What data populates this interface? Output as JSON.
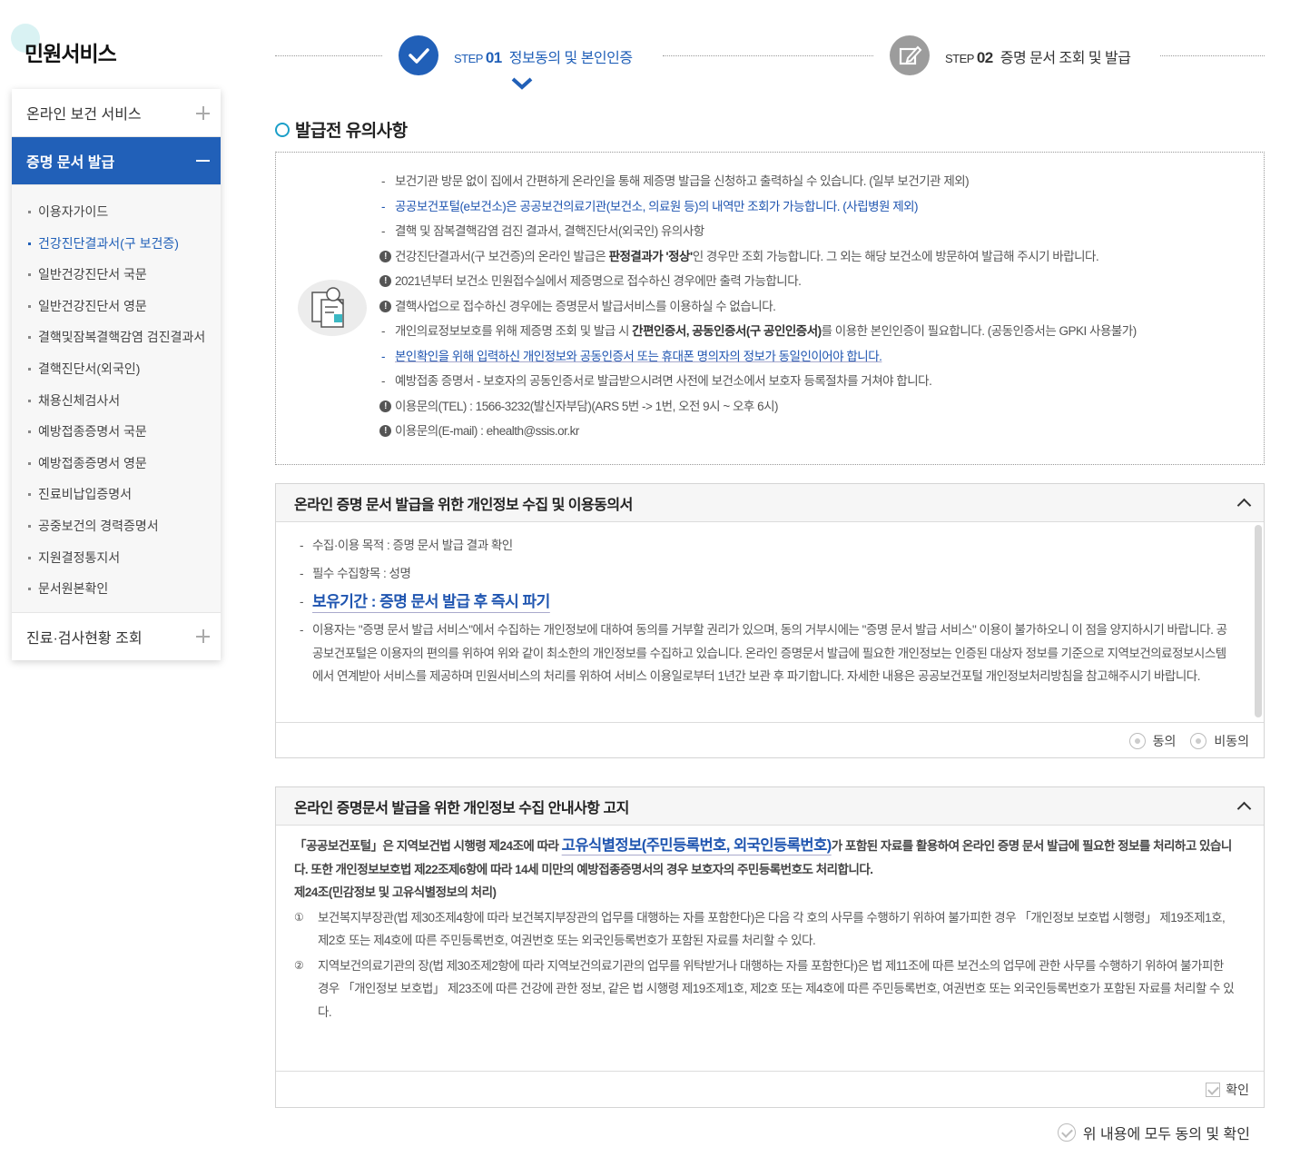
{
  "sidebar": {
    "title": "민원서비스",
    "menus": [
      {
        "label": "온라인 보건 서비스"
      },
      {
        "label": "증명 문서 발급"
      },
      {
        "label": "진료·검사현황 조회"
      }
    ],
    "sub_items": [
      {
        "label": "이용자가이드"
      },
      {
        "label": "건강진단결과서(구 보건증)"
      },
      {
        "label": "일반건강진단서 국문"
      },
      {
        "label": "일반건강진단서 영문"
      },
      {
        "label": "결핵및잠복결핵감염 검진결과서"
      },
      {
        "label": "결핵진단서(외국인)"
      },
      {
        "label": "채용신체검사서"
      },
      {
        "label": "예방접종증명서 국문"
      },
      {
        "label": "예방접종증명서 영문"
      },
      {
        "label": "진료비납입증명서"
      },
      {
        "label": "공중보건의 경력증명서"
      },
      {
        "label": "지원결정통지서"
      },
      {
        "label": "문서원본확인"
      }
    ]
  },
  "steps": [
    {
      "prefix": "STEP",
      "num": "01",
      "label": "정보동의 및 본인인증"
    },
    {
      "prefix": "STEP",
      "num": "02",
      "label": "증명 문서 조회 및 발급"
    }
  ],
  "notice": {
    "title": "발급전 유의사항",
    "items": [
      {
        "type": "dash",
        "text": "보건기관 방문 없이 집에서 간편하게 온라인을 통해 제증명 발급을 신청하고 출력하실 수 있습니다. (일부 보건기관 제외)"
      },
      {
        "type": "dash-blue",
        "text": "공공보건포털(e보건소)은 공공보건의료기관(보건소, 의료원 등)의 내역만 조회가 가능합니다. (사립병원 제외)"
      },
      {
        "type": "dash",
        "text": "결핵 및 잠복결핵감염 검진 결과서, 결핵진단서(외국인) 유의사항"
      },
      {
        "type": "warn",
        "pre": "건강진단결과서(구 보건증)의 온라인 발급은 ",
        "bold": "판정결과가 '정상'",
        "post": "인 경우만 조회 가능합니다. 그 외는 해당 보건소에 방문하여 발급해 주시기 바랍니다."
      },
      {
        "type": "warn",
        "text": "2021년부터 보건소 민원접수실에서 제증명으로 접수하신 경우에만 출력 가능합니다."
      },
      {
        "type": "warn",
        "text": "결핵사업으로 접수하신 경우에는 증명문서 발급서비스를 이용하실 수 없습니다."
      },
      {
        "type": "dash",
        "pre": "개인의료정보보호를 위해 제증명 조회 및 발급 시 ",
        "bold": "간편인증서, 공동인증서(구 공인인증서)",
        "post": "를 이용한 본인인증이 필요합니다. (공동인증서는 GPKI 사용불가)"
      },
      {
        "type": "dash-blue",
        "text": "본인확인을 위해 입력하신 개인정보와 공동인증서 또는 휴대폰 명의자의 정보가 동일인이어야 합니다."
      },
      {
        "type": "dash",
        "text": "예방접종 증명서 - 보호자의 공동인증서로 발급받으시려면 사전에 보건소에서 보호자 등록절차를 거쳐야 합니다."
      },
      {
        "type": "warn",
        "text": "이용문의(TEL) : 1566-3232(발신자부담)(ARS 5번 -> 1번, 오전 9시 ~ 오후 6시)"
      },
      {
        "type": "warn",
        "text": "이용문의(E-mail) : ehealth@ssis.or.kr"
      }
    ]
  },
  "consent1": {
    "title": "온라인 증명 문서 발급을 위한 개인정보 수집 및 이용동의서",
    "purpose": "수집·이용 목적 : 증명 문서 발급 결과 확인",
    "required": "필수 수집항목 : 성명",
    "retention": "보유기간 : 증명 문서 발급 후 즉시 파기",
    "body": "이용자는 \"증명 문서 발급 서비스\"에서 수집하는 개인정보에 대하여 동의를 거부할 권리가 있으며, 동의 거부시에는 \"증명 문서 발급 서비스\" 이용이 불가하오니 이 점을 양지하시기 바랍니다. 공공보건포털은 이용자의 편의를 위하여 위와 같이 최소한의 개인정보를 수집하고 있습니다. 온라인 증명문서 발급에 필요한 개인정보는 인증된 대상자 정보를 기준으로 지역보건의료정보시스템에서 연계받아 서비스를 제공하며 민원서비스의 처리를 위하여 서비스 이용일로부터 1년간 보관 후 파기합니다. 자세한 내용은 공공보건포털 개인정보처리방침을 참고해주시기 바랍니다.",
    "agree": "동의",
    "disagree": "비동의"
  },
  "consent2": {
    "title": "온라인 증명문서 발급을 위한 개인정보 수집 안내사항 고지",
    "intro_pre": "「공공보건포털」은 지역보건법 시행령 제24조에 따라 ",
    "intro_hl": "고유식별정보(주민등록번호, 외국인등록번호)",
    "intro_post": "가 포함된 자료를 활용하여 온라인 증명 문서 발급에 필요한 정보를 처리하고 있습니다. 또한 개인정보보호법 제22조제6항에 따라 14세 미만의 예방접종증명서의 경우 보호자의 주민등록번호도 처리합니다.",
    "article": "제24조(민감정보 및 고유식별정보의 처리)",
    "items": [
      {
        "num": "①",
        "text": "보건복지부장관(법 제30조제4항에 따라 보건복지부장관의 업무를 대행하는 자를 포함한다)은 다음 각 호의 사무를 수행하기 위하여 불가피한 경우 「개인정보 보호법 시행령」 제19조제1호, 제2호 또는 제4호에 따른 주민등록번호, 여권번호 또는 외국인등록번호가 포함된 자료를 처리할 수 있다."
      },
      {
        "num": "②",
        "text": "지역보건의료기관의 장(법 제30조제2항에 따라 지역보건의료기관의 업무를 위탁받거나 대행하는 자를 포함한다)은 법 제11조에 따른 보건소의 업무에 관한 사무를 수행하기 위하여 불가피한 경우 「개인정보 보호법」 제23조에 따른 건강에 관한 정보, 같은 법 시행령 제19조제1호, 제2호 또는 제4호에 따른 주민등록번호, 여권번호 또는 외국인등록번호가 포함된 자료를 처리할 수 있다."
      }
    ],
    "confirm": "확인"
  },
  "all_agree": "위 내용에 모두 동의 및 확인",
  "colors": {
    "primary": "#2160b8",
    "link": "#1f55b0",
    "done_step": "#9c9c9c"
  }
}
